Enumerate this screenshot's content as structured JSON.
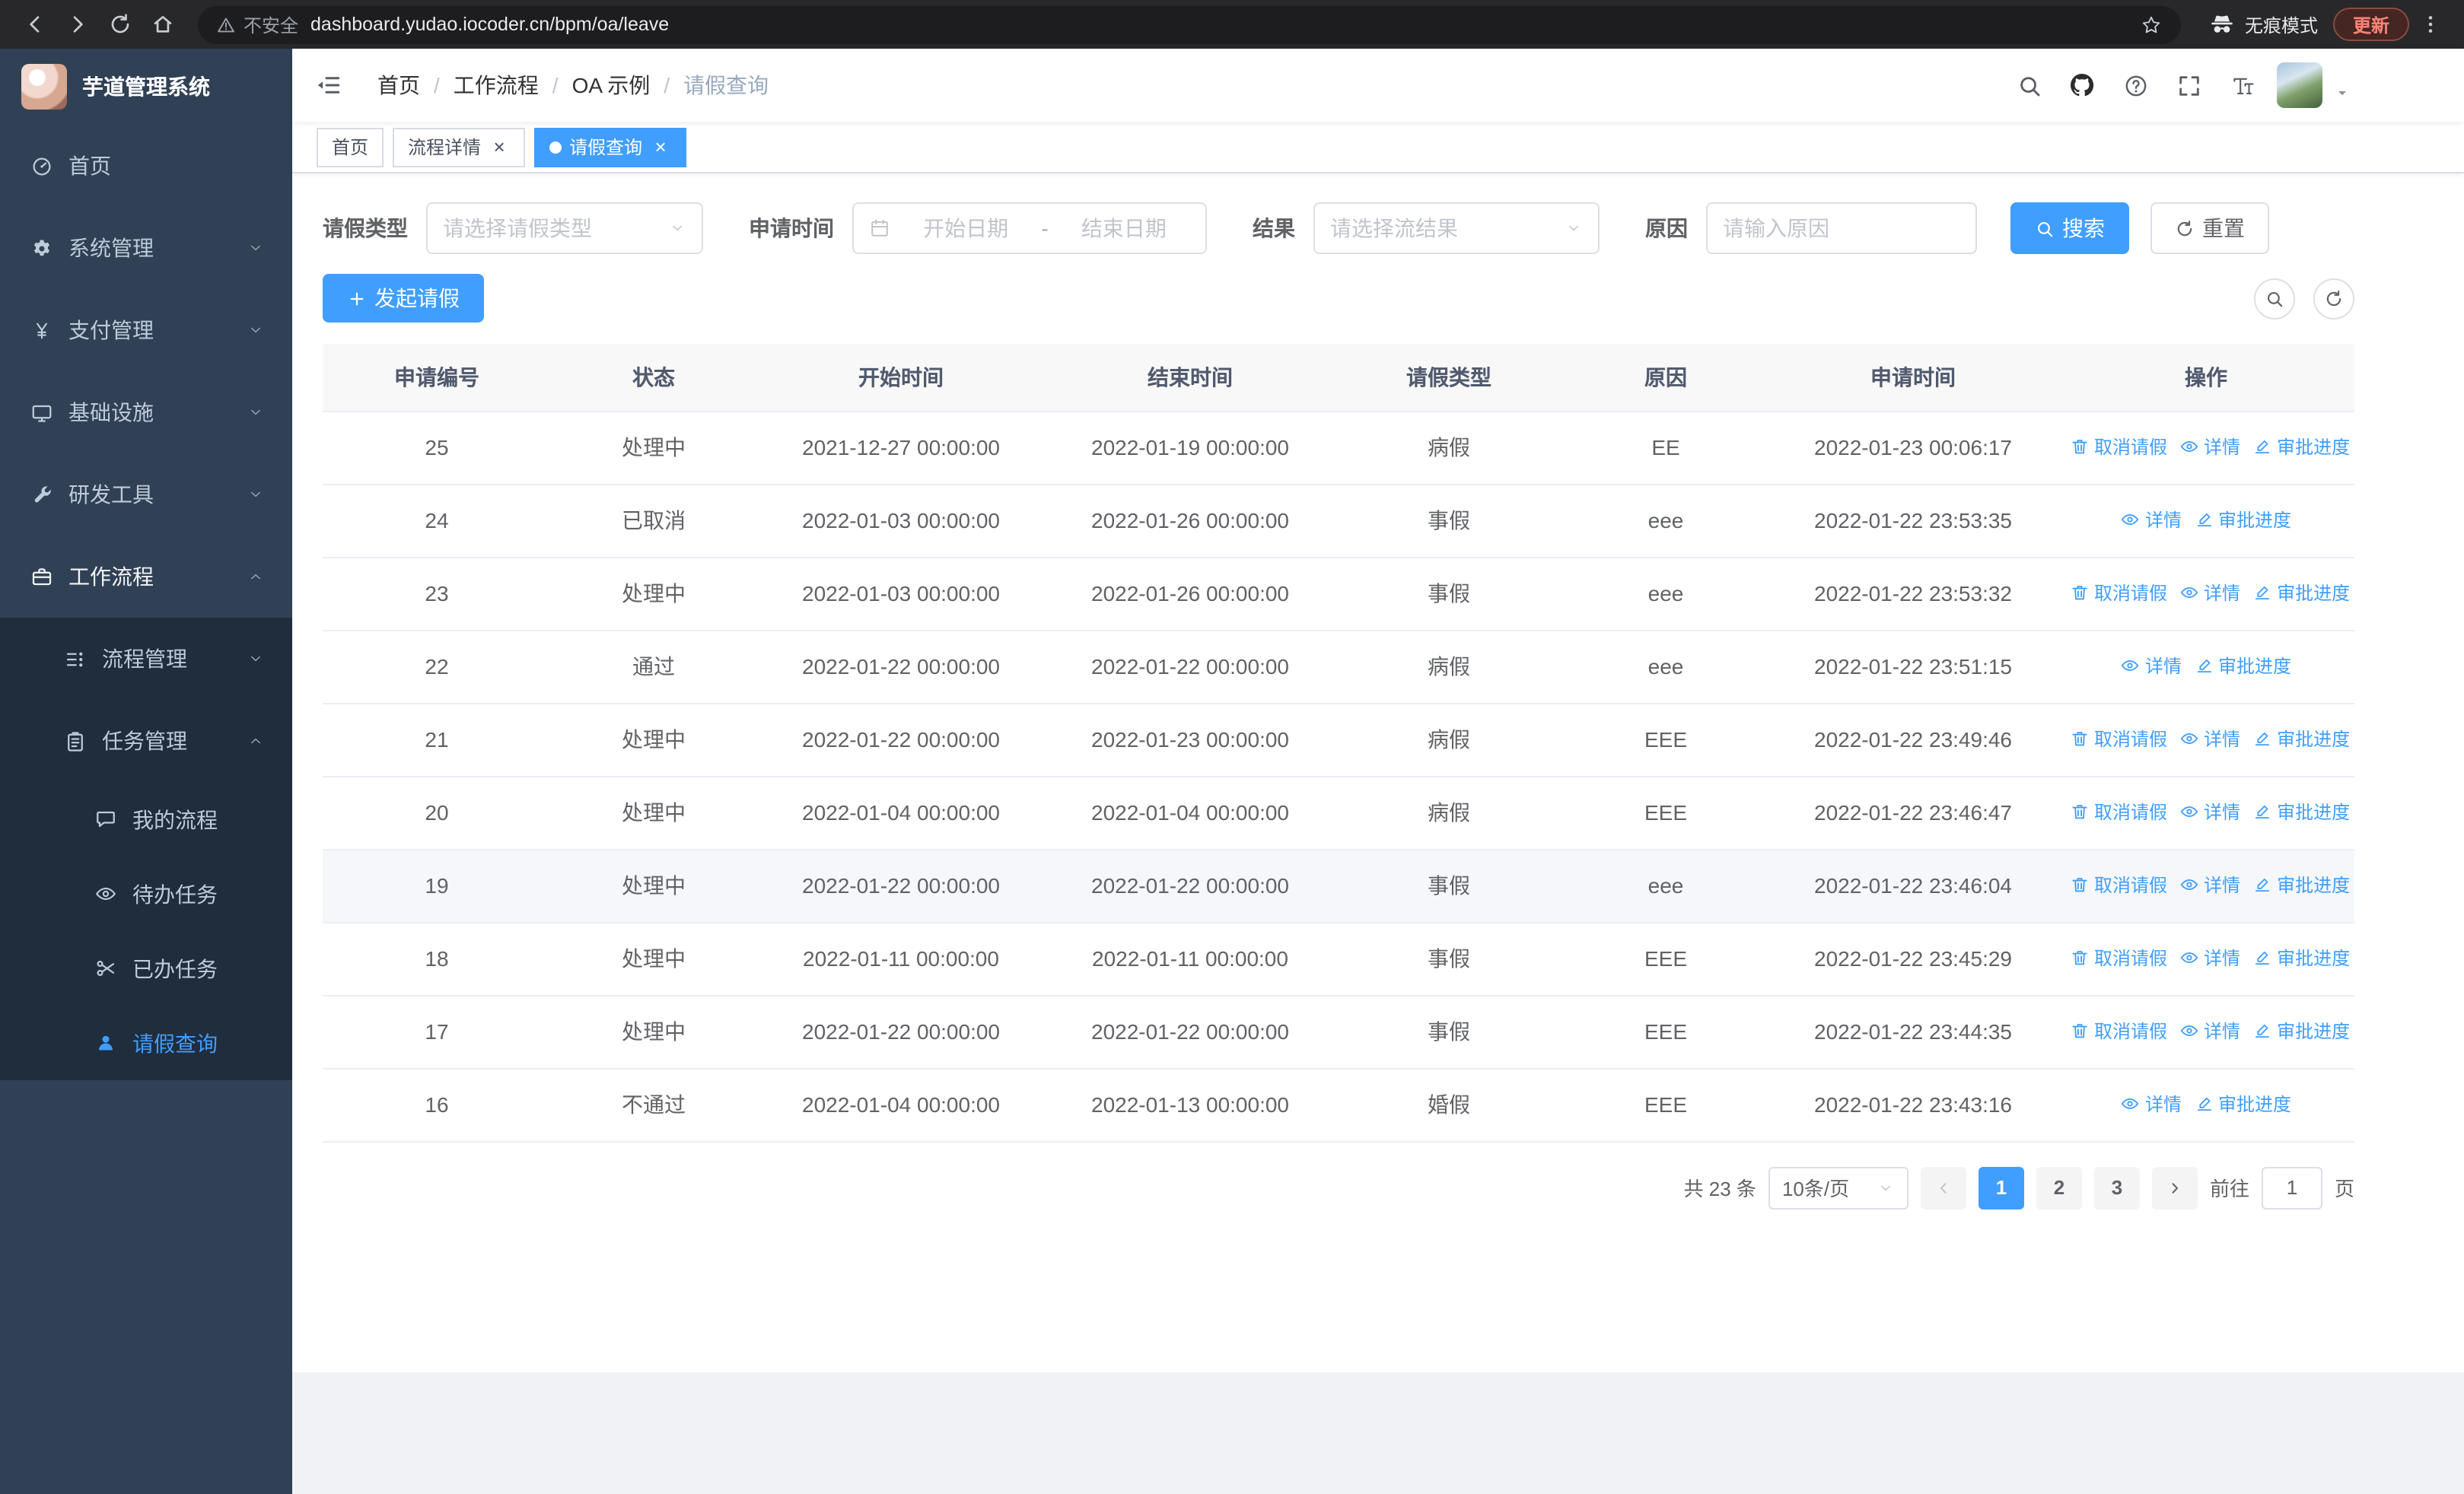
{
  "browser": {
    "security_label": "不安全",
    "url": "dashboard.yudao.iocoder.cn/bpm/oa/leave",
    "incognito_label": "无痕模式",
    "update_label": "更新"
  },
  "sidebar": {
    "app_title": "芋道管理系统",
    "menu": [
      {
        "key": "home",
        "label": "首页",
        "icon": "dashboard-icon",
        "level": 1
      },
      {
        "key": "system",
        "label": "系统管理",
        "icon": "gear-icon",
        "level": 1,
        "arrow": "down"
      },
      {
        "key": "payment",
        "label": "支付管理",
        "icon": "yen-icon",
        "level": 1,
        "arrow": "down"
      },
      {
        "key": "infrastructure",
        "label": "基础设施",
        "icon": "monitor-icon",
        "level": 1,
        "arrow": "down"
      },
      {
        "key": "dev-tools",
        "label": "研发工具",
        "icon": "wrench-icon",
        "level": 1,
        "arrow": "down"
      },
      {
        "key": "workflow",
        "label": "工作流程",
        "icon": "briefcase-icon",
        "level": 1,
        "arrow": "up",
        "highlight": true
      },
      {
        "key": "process-mgmt",
        "label": "流程管理",
        "icon": "tree-list-icon",
        "level": 2,
        "arrow": "down"
      },
      {
        "key": "task-mgmt",
        "label": "任务管理",
        "icon": "clipboard-icon",
        "level": 2,
        "arrow": "up"
      },
      {
        "key": "my-process",
        "label": "我的流程",
        "icon": "chat-bubble-icon",
        "level": 3
      },
      {
        "key": "todo-tasks",
        "label": "待办任务",
        "icon": "eye-icon",
        "level": 3
      },
      {
        "key": "done-tasks",
        "label": "已办任务",
        "icon": "scissors-icon",
        "level": 3
      },
      {
        "key": "leave-query",
        "label": "请假查询",
        "icon": "person-icon",
        "level": 3,
        "active": true
      }
    ]
  },
  "header": {
    "breadcrumb": [
      "首页",
      "工作流程",
      "OA 示例",
      "请假查询"
    ]
  },
  "tabs": [
    {
      "key": "home",
      "label": "首页",
      "closable": false,
      "active": false
    },
    {
      "key": "process-detail",
      "label": "流程详情",
      "closable": true,
      "active": false
    },
    {
      "key": "leave-query",
      "label": "请假查询",
      "closable": true,
      "active": true
    }
  ],
  "filters": {
    "leave_type_label": "请假类型",
    "leave_type_placeholder": "请选择请假类型",
    "apply_time_label": "申请时间",
    "start_date_placeholder": "开始日期",
    "range_separator": "-",
    "end_date_placeholder": "结束日期",
    "result_label": "结果",
    "result_placeholder": "请选择流结果",
    "reason_label": "原因",
    "reason_placeholder": "请输入原因",
    "search_label": "搜索",
    "reset_label": "重置"
  },
  "toolbar": {
    "create_label": "发起请假"
  },
  "table": {
    "columns": [
      "申请编号",
      "状态",
      "开始时间",
      "结束时间",
      "请假类型",
      "原因",
      "申请时间",
      "操作"
    ],
    "action_labels": {
      "cancel": "取消请假",
      "detail": "详情",
      "progress": "审批进度"
    },
    "rows": [
      {
        "id": "25",
        "status": "处理中",
        "start": "2021-12-27 00:00:00",
        "end": "2022-01-19 00:00:00",
        "type": "病假",
        "reason": "EE",
        "applied": "2022-01-23 00:06:17",
        "actions": [
          "cancel",
          "detail",
          "progress"
        ]
      },
      {
        "id": "24",
        "status": "已取消",
        "start": "2022-01-03 00:00:00",
        "end": "2022-01-26 00:00:00",
        "type": "事假",
        "reason": "eee",
        "applied": "2022-01-22 23:53:35",
        "actions": [
          "detail",
          "progress"
        ]
      },
      {
        "id": "23",
        "status": "处理中",
        "start": "2022-01-03 00:00:00",
        "end": "2022-01-26 00:00:00",
        "type": "事假",
        "reason": "eee",
        "applied": "2022-01-22 23:53:32",
        "actions": [
          "cancel",
          "detail",
          "progress"
        ]
      },
      {
        "id": "22",
        "status": "通过",
        "start": "2022-01-22 00:00:00",
        "end": "2022-01-22 00:00:00",
        "type": "病假",
        "reason": "eee",
        "applied": "2022-01-22 23:51:15",
        "actions": [
          "detail",
          "progress"
        ]
      },
      {
        "id": "21",
        "status": "处理中",
        "start": "2022-01-22 00:00:00",
        "end": "2022-01-23 00:00:00",
        "type": "病假",
        "reason": "EEE",
        "applied": "2022-01-22 23:49:46",
        "actions": [
          "cancel",
          "detail",
          "progress"
        ]
      },
      {
        "id": "20",
        "status": "处理中",
        "start": "2022-01-04 00:00:00",
        "end": "2022-01-04 00:00:00",
        "type": "病假",
        "reason": "EEE",
        "applied": "2022-01-22 23:46:47",
        "actions": [
          "cancel",
          "detail",
          "progress"
        ]
      },
      {
        "id": "19",
        "status": "处理中",
        "start": "2022-01-22 00:00:00",
        "end": "2022-01-22 00:00:00",
        "type": "事假",
        "reason": "eee",
        "applied": "2022-01-22 23:46:04",
        "actions": [
          "cancel",
          "detail",
          "progress"
        ],
        "highlighted": true
      },
      {
        "id": "18",
        "status": "处理中",
        "start": "2022-01-11 00:00:00",
        "end": "2022-01-11 00:00:00",
        "type": "事假",
        "reason": "EEE",
        "applied": "2022-01-22 23:45:29",
        "actions": [
          "cancel",
          "detail",
          "progress"
        ]
      },
      {
        "id": "17",
        "status": "处理中",
        "start": "2022-01-22 00:00:00",
        "end": "2022-01-22 00:00:00",
        "type": "事假",
        "reason": "EEE",
        "applied": "2022-01-22 23:44:35",
        "actions": [
          "cancel",
          "detail",
          "progress"
        ]
      },
      {
        "id": "16",
        "status": "不通过",
        "start": "2022-01-04 00:00:00",
        "end": "2022-01-13 00:00:00",
        "type": "婚假",
        "reason": "EEE",
        "applied": "2022-01-22 23:43:16",
        "actions": [
          "detail",
          "progress"
        ]
      }
    ]
  },
  "pagination": {
    "total_label": "共 23 条",
    "page_size": "10条/页",
    "pages": [
      "1",
      "2",
      "3"
    ],
    "active_page": "1",
    "goto_label": "前往",
    "goto_value": "1",
    "goto_suffix": "页"
  },
  "colors": {
    "primary": "#409eff",
    "sidebar-bg": "#304156",
    "submenu-bg": "#1f2d3d"
  }
}
